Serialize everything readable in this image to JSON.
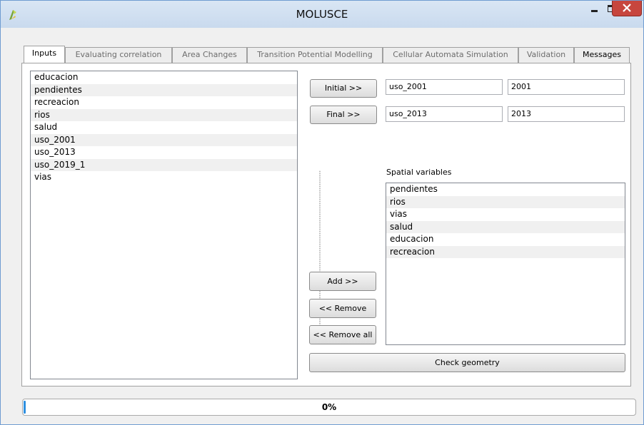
{
  "window": {
    "title": "MOLUSCE",
    "accent": "#c7463e"
  },
  "tabs": [
    {
      "label": "Inputs",
      "active": true
    },
    {
      "label": "Evaluating correlation"
    },
    {
      "label": "Area Changes"
    },
    {
      "label": "Transition Potential Modelling"
    },
    {
      "label": "Cellular Automata Simulation"
    },
    {
      "label": "Validation"
    },
    {
      "label": "Messages"
    }
  ],
  "layers": [
    "educacion",
    "pendientes",
    "recreacion",
    "rios",
    "salud",
    "uso_2001",
    "uso_2013",
    "uso_2019_1",
    "vias"
  ],
  "initial": {
    "button_label": "Initial >>",
    "layer": "uso_2001",
    "year": "2001"
  },
  "final": {
    "button_label": "Final >>",
    "layer": "uso_2013",
    "year": "2013"
  },
  "spatial_variables": {
    "label": "Spatial variables",
    "items": [
      "pendientes",
      "rios",
      "vias",
      "salud",
      "educacion",
      "recreacion"
    ]
  },
  "buttons": {
    "add": "Add >>",
    "remove": "<< Remove",
    "remove_all": "<< Remove all",
    "check_geometry": "Check geometry"
  },
  "progress": {
    "text": "0%",
    "value": 0,
    "color": "#2d8fe0"
  },
  "icons": {
    "app": "qgis-icon",
    "min": "minimize-icon",
    "max": "maximize-icon",
    "close": "close-icon"
  }
}
